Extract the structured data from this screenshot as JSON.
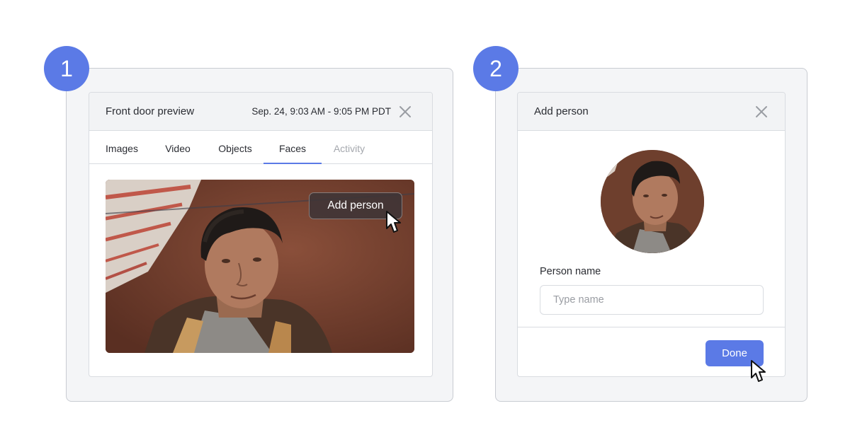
{
  "steps": {
    "first": "1",
    "second": "2"
  },
  "preview_card": {
    "title": "Front door preview",
    "date_range": "Sep. 24, 9:03 AM - 9:05 PM PDT",
    "close_icon": "close-icon",
    "tabs": [
      {
        "label": "Images",
        "state": "normal"
      },
      {
        "label": "Video",
        "state": "normal"
      },
      {
        "label": "Objects",
        "state": "normal"
      },
      {
        "label": "Faces",
        "state": "active"
      },
      {
        "label": "Activity",
        "state": "disabled"
      }
    ],
    "add_person_button": "Add person"
  },
  "add_person_dialog": {
    "title": "Add person",
    "close_icon": "close-icon",
    "field_label": "Person name",
    "input": {
      "value": "",
      "placeholder": "Type name"
    },
    "done_button": "Done"
  },
  "colors": {
    "accent": "#5b7ae6",
    "frame_bg": "#f4f5f7",
    "header_bg": "#f2f3f5",
    "border": "#d9dce1"
  }
}
